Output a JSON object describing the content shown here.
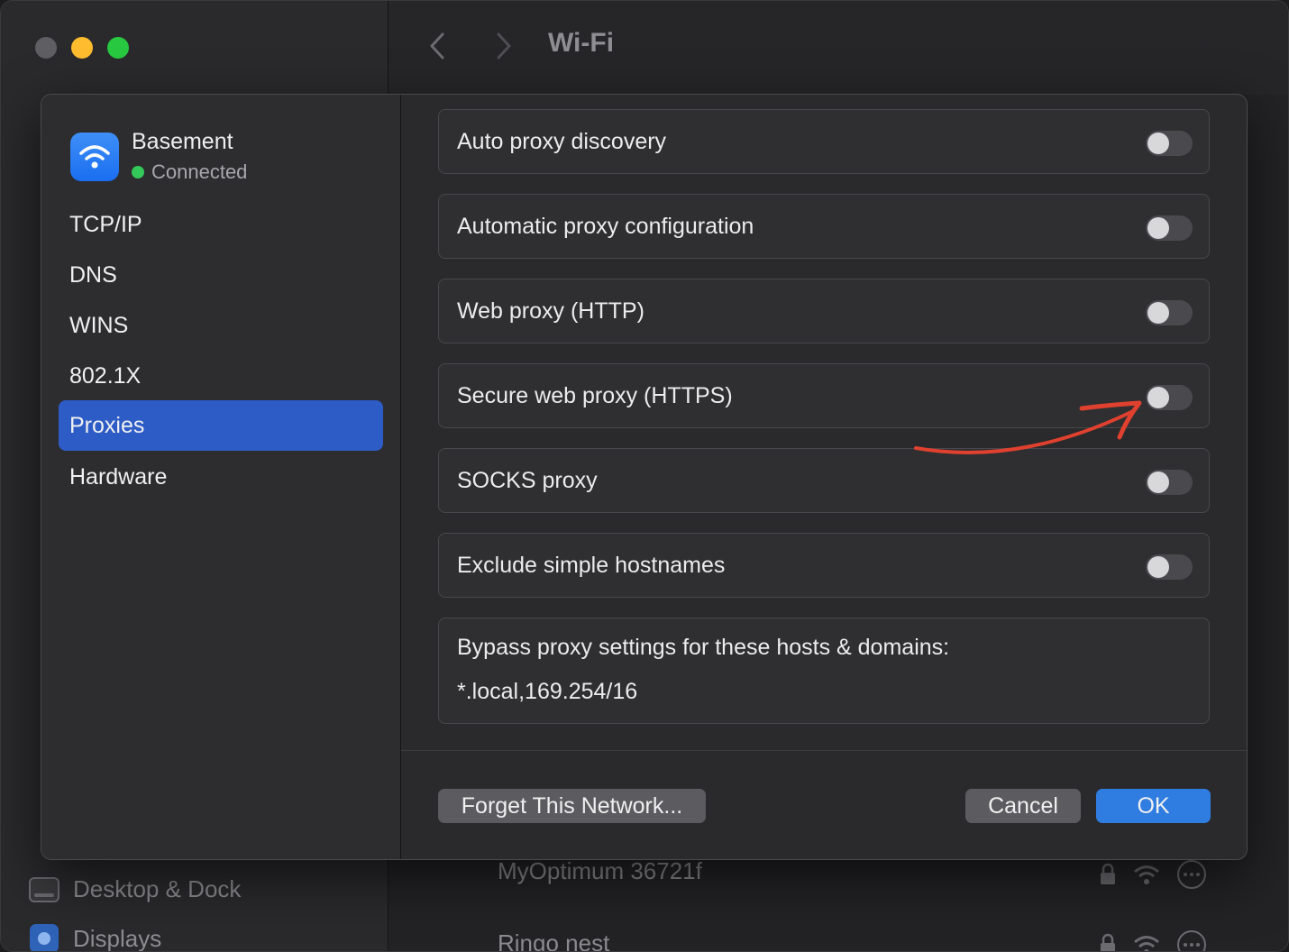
{
  "window": {
    "title": "Wi-Fi",
    "traffic_lights": {
      "close": "#5f5e62",
      "minimize": "#febc2e",
      "zoom": "#28c840"
    }
  },
  "background_sidebar": {
    "desktop_dock": "Desktop & Dock",
    "displays": "Displays"
  },
  "background_networks": [
    {
      "name": "MyOptimum 36721f"
    },
    {
      "name": "Ringo nest"
    }
  ],
  "dialog": {
    "network": {
      "name": "Basement",
      "status": "Connected",
      "icon": "wifi-icon",
      "status_color": "#34c759"
    },
    "sidebar_items": [
      {
        "label": "TCP/IP"
      },
      {
        "label": "DNS"
      },
      {
        "label": "WINS"
      },
      {
        "label": "802.1X"
      },
      {
        "label": "Proxies",
        "selected": true
      },
      {
        "label": "Hardware"
      }
    ],
    "proxy_options": [
      {
        "label": "Auto proxy discovery",
        "enabled": false
      },
      {
        "label": "Automatic proxy configuration",
        "enabled": false
      },
      {
        "label": "Web proxy (HTTP)",
        "enabled": false
      },
      {
        "label": "Secure web proxy (HTTPS)",
        "enabled": false
      },
      {
        "label": "SOCKS proxy",
        "enabled": false
      },
      {
        "label": "Exclude simple hostnames",
        "enabled": false
      }
    ],
    "bypass": {
      "label": "Bypass proxy settings for these hosts & domains:",
      "value": "*.local,169.254/16"
    },
    "buttons": {
      "forget": "Forget This Network...",
      "cancel": "Cancel",
      "ok": "OK"
    },
    "accent_color": "#2f7de1",
    "annotation_color": "#e0412f"
  }
}
